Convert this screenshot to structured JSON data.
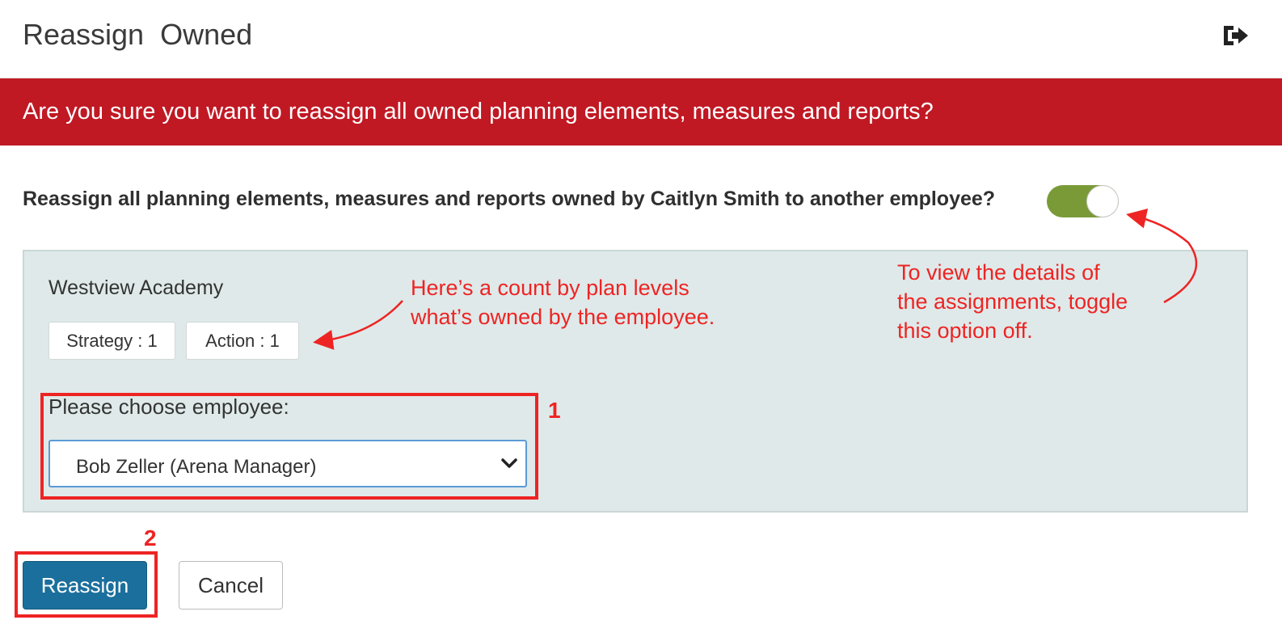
{
  "header": {
    "title": "Reassign  Owned",
    "exit_icon": "sign-out-icon"
  },
  "banner": {
    "text": "Are you sure you want to reassign all owned planning elements, measures and reports?",
    "color": "#c01924"
  },
  "reassign_question": {
    "text": "Reassign all planning elements, measures and reports owned by Caitlyn Smith to another employee?",
    "toggle_on": true,
    "toggle_color": "#7a9a38"
  },
  "panel": {
    "organization": "Westview Academy",
    "counts": [
      {
        "label": "Strategy : 1"
      },
      {
        "label": "Action : 1"
      }
    ],
    "choose_label": "Please choose employee:",
    "selected_employee": "Bob Zeller (Arena Manager)"
  },
  "buttons": {
    "reassign": "Reassign",
    "cancel": "Cancel",
    "primary_color": "#1b6f9c"
  },
  "annotations": {
    "count_note_line1": "Here’s a count by plan levels",
    "count_note_line2": "what’s owned by the employee.",
    "toggle_note_line1": "To view the details of",
    "toggle_note_line2": "the assignments, toggle",
    "toggle_note_line3": "this option off.",
    "step1": "1",
    "step2": "2",
    "color": "#ee2424"
  }
}
